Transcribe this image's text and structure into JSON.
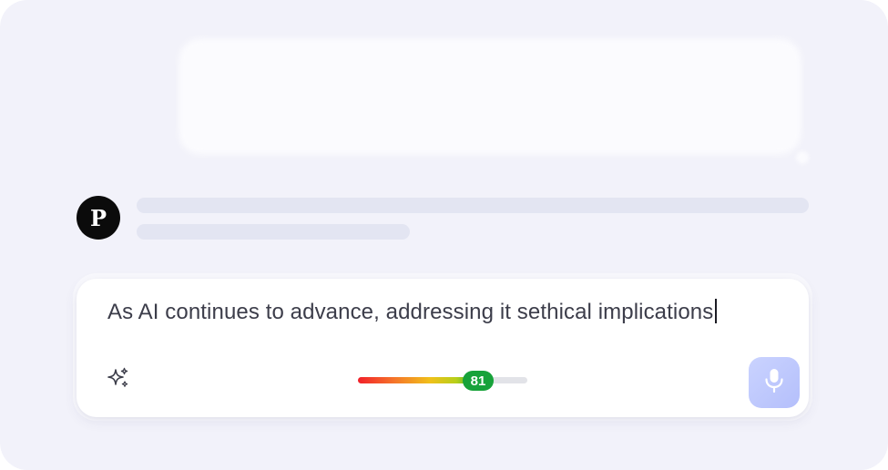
{
  "avatar": {
    "initial": "P"
  },
  "composer": {
    "text": "As AI continues to advance, addressing it sethical implications"
  },
  "score": {
    "value": 81,
    "label": "81",
    "fill_fraction": 0.71
  },
  "icons": {
    "assist": "sparkles-icon",
    "voice": "microphone-icon"
  },
  "colors": {
    "background": "#f2f2fa",
    "skeleton": "#e3e5f2",
    "score_badge": "#17a23a",
    "mic_button": "#c2ccfe",
    "avatar": "#0b0b0b"
  }
}
